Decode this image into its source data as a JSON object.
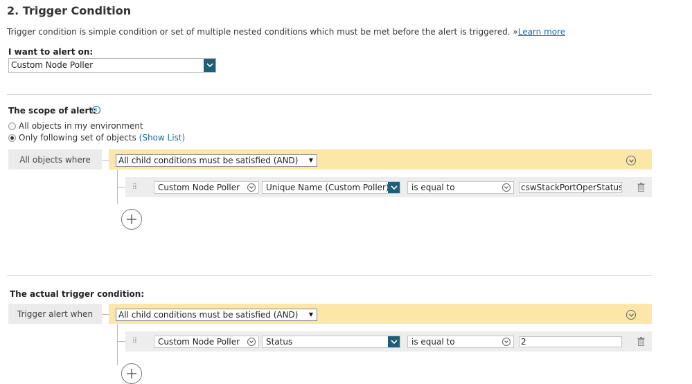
{
  "section": {
    "title": "2. Trigger Condition",
    "description": "Trigger condition is simple condition or set of multiple nested conditions which must be met before the alert is triggered. »",
    "learn_more": "Learn more"
  },
  "alert_on": {
    "label": "I want to alert on:",
    "value": "Custom Node Poller"
  },
  "scope": {
    "label": "The scope of alert:",
    "options": [
      {
        "label": "All objects in my environment",
        "checked": false
      },
      {
        "label": "Only following set of objects",
        "checked": true
      }
    ],
    "show_list": "(Show List)",
    "group_label": "All objects where",
    "group_operator": "All child conditions must be satisfied (AND)",
    "condition": {
      "entity": "Custom Node Poller",
      "field": "Unique Name (Custom Poller)",
      "operator": "is equal to",
      "value": "cswStackPortOperStatus"
    }
  },
  "trigger": {
    "label": "The actual trigger condition:",
    "group_label": "Trigger alert when",
    "group_operator": "All child conditions must be satisfied (AND)",
    "condition": {
      "entity": "Custom Node Poller",
      "field": "Status",
      "operator": "is equal to",
      "value": "2"
    }
  },
  "colors": {
    "accent": "#1e5e77",
    "group_bar": "#fce7a8",
    "link": "#1a6aa6"
  }
}
